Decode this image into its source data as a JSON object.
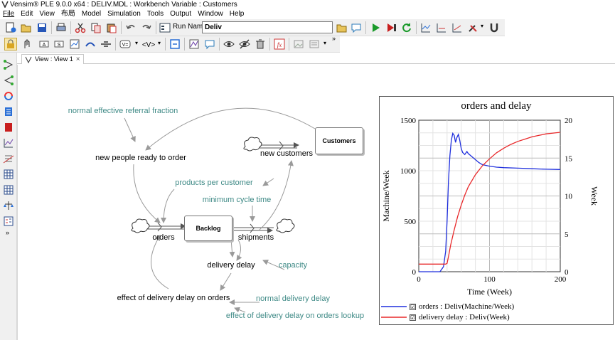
{
  "window": {
    "title": "Vensim® PLE 9.0.0 x64 : DELIV.MDL : Workbench Variable : Customers"
  },
  "menu": [
    "File",
    "Edit",
    "View",
    "布局",
    "Model",
    "Simulation",
    "Tools",
    "Output",
    "Window",
    "Help"
  ],
  "toolbar": {
    "run_name_label": "Run Name:",
    "run_name_value": "Deliv",
    "overflow": "»"
  },
  "tab": {
    "label": "View : View 1",
    "close": "×"
  },
  "sidebar": {
    "more": "»"
  },
  "diagram": {
    "stocks": {
      "backlog": "Backlog",
      "customers": "Customers"
    },
    "variables": {
      "normal_referral": "normal effective referral fraction",
      "new_people": "new people ready to order",
      "new_customers": "new customers",
      "products_per_customer": "products per customer",
      "minimum_cycle_time": "minimum cycle time",
      "orders": "orders",
      "shipments": "shipments",
      "delivery_delay": "delivery delay",
      "capacity": "capacity",
      "effect_delay": "effect of delivery delay on orders",
      "normal_delivery_delay": "normal delivery delay",
      "effect_lookup": "effect of delivery delay on orders lookup"
    }
  },
  "chart_data": {
    "type": "line",
    "title": "orders and delay",
    "xlabel": "Time (Week)",
    "ylabel_left": "Machine/Week",
    "ylabel_right": "Week",
    "xlim": [
      0,
      200
    ],
    "ylim_left": [
      0,
      1500
    ],
    "ylim_right": [
      0,
      20
    ],
    "xticks": [
      "0",
      "100",
      "200"
    ],
    "yticks_left": [
      "0",
      "500",
      "1000",
      "1500"
    ],
    "yticks_right": [
      "0",
      "5",
      "10",
      "15",
      "20"
    ],
    "grid": true,
    "series": [
      {
        "name": "orders : Deliv(Machine/Week)",
        "color": "#1f2fdd",
        "axis": "left",
        "x": [
          0,
          10,
          20,
          30,
          35,
          38,
          40,
          42,
          44,
          46,
          48,
          50,
          52,
          54,
          56,
          58,
          60,
          62,
          65,
          68,
          70,
          75,
          80,
          85,
          90,
          100,
          110,
          120,
          140,
          160,
          180,
          200
        ],
        "y": [
          0,
          0,
          0,
          0,
          50,
          200,
          500,
          900,
          1150,
          1300,
          1370,
          1350,
          1280,
          1330,
          1360,
          1300,
          1220,
          1180,
          1160,
          1190,
          1170,
          1140,
          1110,
          1080,
          1060,
          1045,
          1035,
          1030,
          1025,
          1020,
          1015,
          1012
        ]
      },
      {
        "name": "delivery delay : Deliv(Week)",
        "color": "#e8282a",
        "axis": "right",
        "x": [
          0,
          10,
          20,
          30,
          35,
          38,
          40,
          42,
          45,
          50,
          55,
          60,
          65,
          70,
          80,
          90,
          100,
          110,
          120,
          130,
          140,
          150,
          160,
          170,
          180,
          190,
          200
        ],
        "y": [
          1,
          1,
          1,
          1,
          1,
          1,
          1.1,
          2,
          3.5,
          5.5,
          7.3,
          8.8,
          10.1,
          11.2,
          12.8,
          14,
          14.9,
          15.7,
          16.3,
          16.8,
          17.2,
          17.5,
          17.8,
          18,
          18.2,
          18.3,
          18.4
        ]
      }
    ]
  },
  "colors": {
    "link_teal": "#3f8a86",
    "orders_line": "#1f2fdd",
    "delay_line": "#e8282a"
  }
}
